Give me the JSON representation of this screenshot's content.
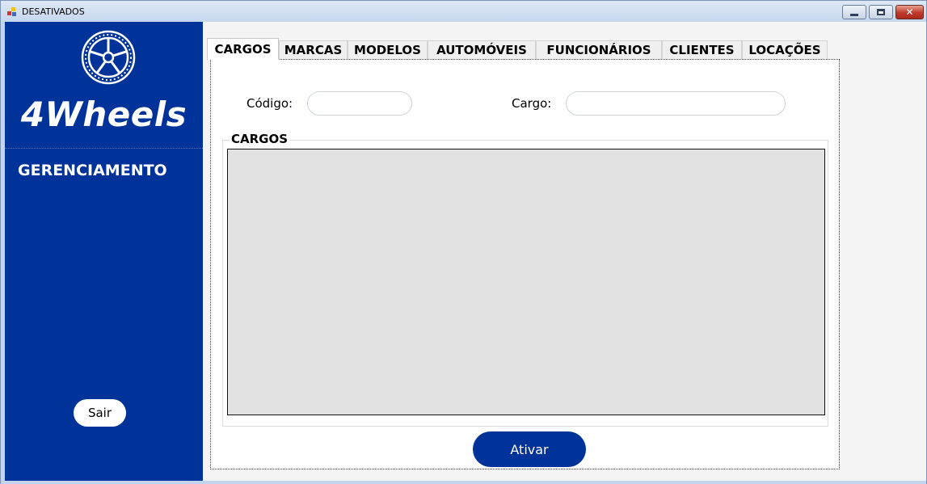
{
  "window": {
    "title": "DESATIVADOS"
  },
  "sidebar": {
    "brand": "4Wheels",
    "section": "GERENCIAMENTO",
    "exit_label": "Sair",
    "logo_icon": "car-wheel-icon",
    "background": "#003399"
  },
  "tabs": [
    "CARGOS",
    "MARCAS",
    "MODELOS",
    "AUTOMÓVEIS",
    "FUNCIONÁRIOS",
    "CLIENTES",
    "LOCAÇÕES"
  ],
  "active_tab": "CARGOS",
  "form": {
    "codigo_label": "Código:",
    "codigo_value": "",
    "cargo_label": "Cargo:",
    "cargo_value": ""
  },
  "group": {
    "title": "CARGOS"
  },
  "actions": {
    "activate_label": "Ativar"
  },
  "colors": {
    "accent": "#003399",
    "grid_bg": "#e2e2e2"
  }
}
